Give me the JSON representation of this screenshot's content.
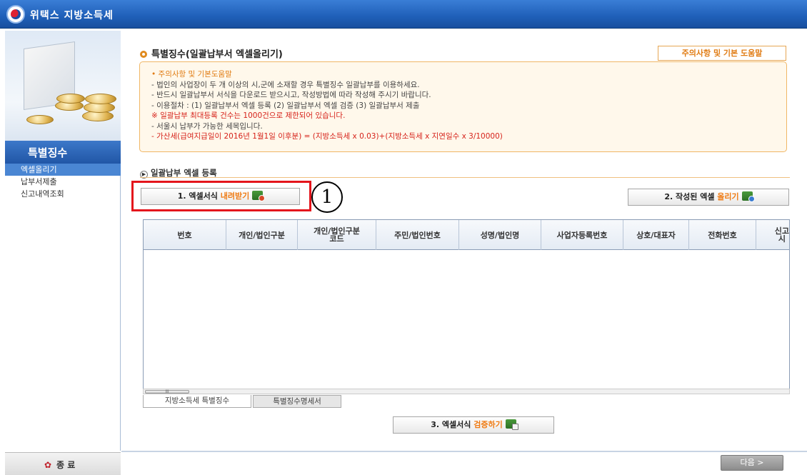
{
  "app": {
    "title": "위택스 지방소득세"
  },
  "sidebar": {
    "title": "특별징수",
    "items": [
      {
        "label": "엑셀올리기",
        "active": true
      },
      {
        "label": "납부서제출",
        "active": false
      },
      {
        "label": "신고내역조회",
        "active": false
      }
    ],
    "exit_label": "종 료"
  },
  "page": {
    "title": "특별징수(일괄납부서 엑셀올리기)",
    "help_button": "주의사항 및 기본 도움말",
    "notice": {
      "heading": "• 주의사항 및 기본도움말",
      "lines": [
        "- 법인의 사업장이 두 개 이상의 시,군에 소재할 경우 특별징수 일괄납부를 이용하세요.",
        "- 반드시 일괄납부서 서식을 다운로드 받으시고, 작성방법에 따라 작성해 주시기 바랍니다.",
        "- 이용절차 : (1) 일괄납부서 엑셀 등록  (2) 일괄납부서 엑셀 검증 (3) 일괄납부서 제출"
      ],
      "limit_line": "※ 일괄납부 최대등록 건수는 1000건으로 제한되어 있습니다.",
      "seoul_line": "- 서울시 납부가 가능한 세목입니다.",
      "penalty_line": "- 가산세(급여지급일이 2016년 1월1일 이후분) = (지방소득세 x 0.03)+(지방소득세 x 지연일수 x 3/10000)"
    },
    "sub_title": "일괄납부 엑셀 등록",
    "download_button": {
      "prefix": "1. 엑셀서식 ",
      "accent": "내려받기"
    },
    "upload_button": {
      "prefix": "2. 작성된 엑셀 ",
      "accent": "올리기"
    },
    "verify_button": {
      "prefix": "3. 엑셀서식 ",
      "accent": "검증하기"
    },
    "callout_number": "1",
    "grid": {
      "columns": [
        "번호",
        "개인/법인구분",
        "개인/법인구분\n코드",
        "주민/법인번호",
        "성명/법인명",
        "사업자등록번호",
        "상호/대표자",
        "전화번호",
        "신고\n시"
      ],
      "rows": []
    },
    "scroll_thumb": "III",
    "sheet_tabs": [
      {
        "label": "지방소득세 특별징수",
        "active": true
      },
      {
        "label": "특별징수명세서",
        "active": false
      }
    ],
    "next_button": "다음 >"
  },
  "colors": {
    "title_bar": "#1f5fb8",
    "accent_orange": "#ef7a12",
    "notice_bg": "#fff8eb",
    "notice_border": "#f0b766",
    "alert_red": "#d6221a",
    "highlight_red": "#e4151c"
  }
}
